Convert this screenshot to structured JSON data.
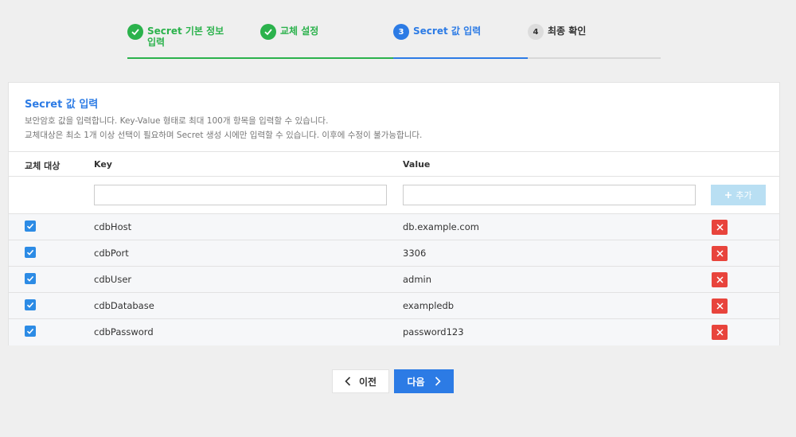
{
  "stepper": {
    "steps": [
      {
        "number": "",
        "label": "Secret 기본 정보 입력",
        "state": "done"
      },
      {
        "number": "",
        "label": "교체 설정",
        "state": "done"
      },
      {
        "number": "3",
        "label": "Secret 값 입력",
        "state": "active"
      },
      {
        "number": "4",
        "label": "최종 확인",
        "state": "pending"
      }
    ]
  },
  "section": {
    "title": "Secret 값 입력",
    "description_1": "보안암호 값을 입력합니다. Key-Value 형태로 최대 100개 항목을 입력할 수 있습니다.",
    "description_2": "교체대상은 최소 1개 이상 선택이 필요하며 Secret 생성 시에만 입력할 수 있습니다. 이후에 수정이 불가능합니다."
  },
  "table": {
    "headers": {
      "target": "교체 대상",
      "key": "Key",
      "value": "Value"
    },
    "new_entry": {
      "key_value": "",
      "key_placeholder": "",
      "value_value": "",
      "value_placeholder": "",
      "add_label": "추가"
    },
    "rows": [
      {
        "checked": true,
        "key": "cdbHost",
        "value": "db.example.com"
      },
      {
        "checked": true,
        "key": "cdbPort",
        "value": "3306"
      },
      {
        "checked": true,
        "key": "cdbUser",
        "value": "admin"
      },
      {
        "checked": true,
        "key": "cdbDatabase",
        "value": "exampledb"
      },
      {
        "checked": true,
        "key": "cdbPassword",
        "value": "password123"
      }
    ]
  },
  "footer": {
    "prev_label": "이전",
    "next_label": "다음"
  },
  "colors": {
    "done": "#2bb24c",
    "active": "#2c7be5",
    "delete": "#e8443c",
    "add_disabled": "#b9dff3"
  }
}
